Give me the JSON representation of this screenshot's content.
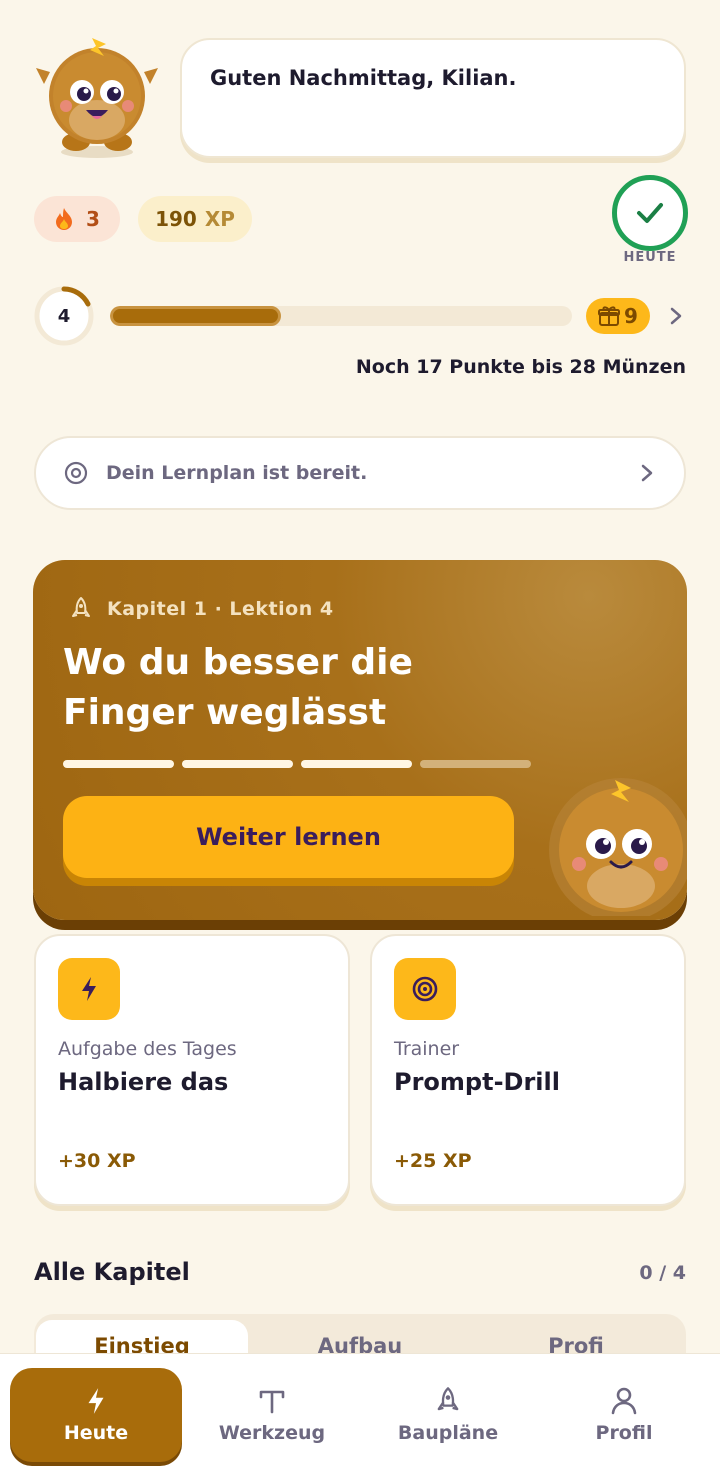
{
  "greeting": {
    "text": "Guten Nachmittag, Kilian."
  },
  "stats": {
    "streak": "3",
    "xp_value": "190",
    "xp_unit": "XP"
  },
  "today_badge": {
    "label": "HEUTE"
  },
  "level": {
    "number": "4",
    "progress_fraction": 0.37,
    "gift_count": "9",
    "points_text": "Noch 17 Punkte bis 28 Münzen"
  },
  "plan_banner": {
    "text": "Dein Lernplan ist bereit."
  },
  "hero": {
    "kicker": "Kapitel 1 · Lektion 4",
    "title": "Wo du besser die Finger weglässt",
    "segments_done": 3,
    "segments_total": 4,
    "button": "Weiter lernen"
  },
  "cards": [
    {
      "label": "Aufgabe des Tages",
      "title": "Halbiere das",
      "xp": "+30 XP",
      "icon": "lightning-icon"
    },
    {
      "label": "Trainer",
      "title": "Prompt-Drill",
      "xp": "+25 XP",
      "icon": "target-icon"
    }
  ],
  "chapters": {
    "title": "Alle Kapitel",
    "count": "0 / 4",
    "tabs": [
      "Einstieg",
      "Aufbau",
      "Profi"
    ]
  },
  "nav": [
    {
      "label": "Heute",
      "icon": "lightning-icon"
    },
    {
      "label": "Werkzeug",
      "icon": "tool-icon"
    },
    {
      "label": "Baupläne",
      "icon": "rocket-icon"
    },
    {
      "label": "Profil",
      "icon": "person-icon"
    }
  ],
  "colors": {
    "accent": "#A86C0B",
    "button": "#FDB214",
    "success": "#20A055",
    "background": "#FBF6EA"
  }
}
